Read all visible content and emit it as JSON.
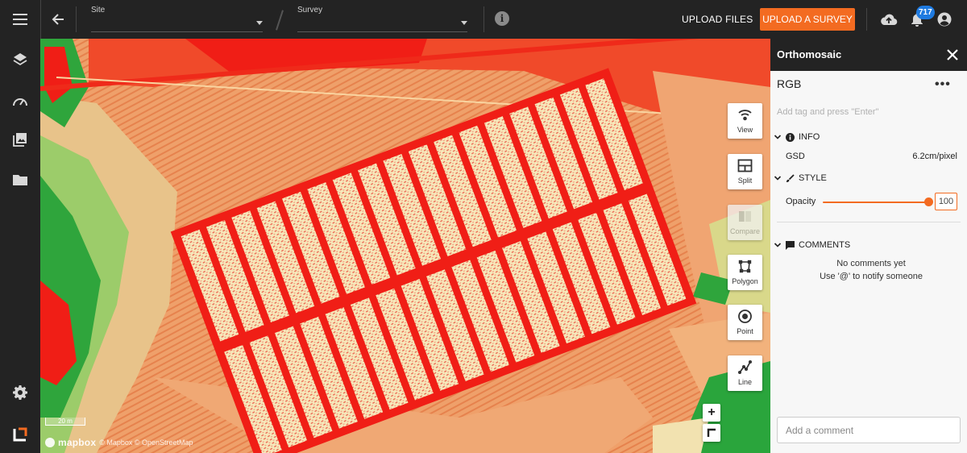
{
  "topbar": {
    "site_label": "Site",
    "survey_label": "Survey",
    "upload_files": "UPLOAD FILES",
    "upload_survey": "UPLOAD A SURVEY",
    "notification_count": "717",
    "accent_color": "#f36b21",
    "badge_color": "#1e7ae0",
    "icons": [
      "menu-icon",
      "back-arrow-icon",
      "info-icon",
      "cloud-upload-icon",
      "bell-icon",
      "account-icon"
    ]
  },
  "sidebar": {
    "icons": [
      "layers-icon",
      "dashboard-icon",
      "gallery-icon",
      "folder-icon",
      "settings-icon",
      "app-logo"
    ]
  },
  "map": {
    "tools": [
      {
        "name": "view",
        "label": "View",
        "enabled": true
      },
      {
        "name": "split",
        "label": "Split",
        "enabled": true
      },
      {
        "name": "compare",
        "label": "Compare",
        "enabled": false
      },
      {
        "name": "polygon",
        "label": "Polygon",
        "enabled": true
      },
      {
        "name": "point",
        "label": "Point",
        "enabled": true
      },
      {
        "name": "line",
        "label": "Line",
        "enabled": true
      }
    ],
    "zoom_in": "+",
    "scale": "20 m",
    "attribution_logo": "mapbox",
    "attribution_text": "© Mapbox © OpenStreetMap",
    "colors": {
      "red": "#f01e16",
      "orange": "#f2a06a",
      "cream": "#f6e7b8",
      "green": "#2aa53c"
    }
  },
  "panel": {
    "title": "Orthomosaic",
    "layer_name": "RGB",
    "more": "•••",
    "tag_placeholder": "Add tag and press \"Enter\"",
    "info": {
      "heading": "INFO",
      "gsd_label": "GSD",
      "gsd_value": "6.2cm/pixel"
    },
    "style": {
      "heading": "STYLE",
      "opacity_label": "Opacity",
      "opacity_value": "100",
      "opacity_percent": 100
    },
    "comments": {
      "heading": "COMMENTS",
      "empty_line1": "No comments yet",
      "empty_line2": "Use '@' to notify someone",
      "input_placeholder": "Add a comment"
    }
  }
}
